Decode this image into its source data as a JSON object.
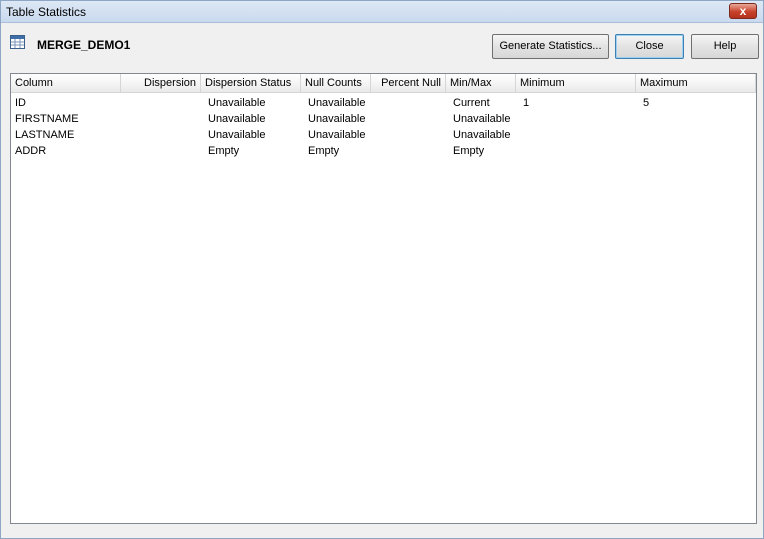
{
  "window": {
    "title": "Table Statistics",
    "close_glyph": "x"
  },
  "table": {
    "name": "MERGE_DEMO1",
    "icon": "table-icon"
  },
  "buttons": {
    "generate": "Generate Statistics...",
    "close": "Close",
    "help": "Help"
  },
  "grid": {
    "columns": [
      "Column",
      "Dispersion",
      "Dispersion Status",
      "Null Counts",
      "Percent Null",
      "Min/Max",
      "Minimum",
      "Maximum"
    ],
    "rows": [
      [
        "ID",
        "",
        "Unavailable",
        "Unavailable",
        "",
        "Current",
        "1",
        "5"
      ],
      [
        "FIRSTNAME",
        "",
        "Unavailable",
        "Unavailable",
        "",
        "Unavailable",
        "",
        ""
      ],
      [
        "LASTNAME",
        "",
        "Unavailable",
        "Unavailable",
        "",
        "Unavailable",
        "",
        ""
      ],
      [
        "ADDR",
        "",
        "Empty",
        "Empty",
        "",
        "Empty",
        "",
        ""
      ]
    ]
  }
}
